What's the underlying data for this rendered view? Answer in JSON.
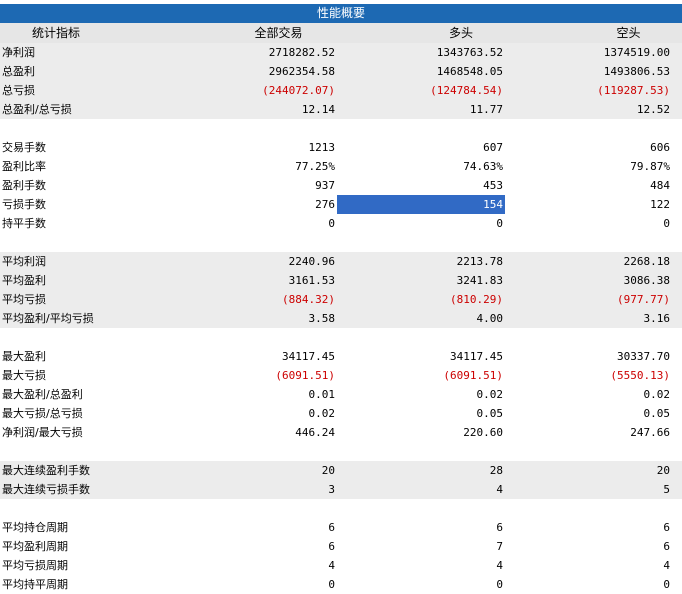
{
  "title": "性能概要",
  "header": [
    "统计指标",
    "全部交易",
    "多头",
    "空头"
  ],
  "colors": {
    "title_bg": "#1d69b3",
    "negative": "#cc0000",
    "selection": "#316ac5",
    "shade": "#ececec"
  },
  "section1": [
    [
      "净利润",
      "2718282.52",
      "1343763.52",
      "1374519.00"
    ],
    [
      "总盈利",
      "2962354.58",
      "1468548.05",
      "1493806.53"
    ],
    [
      "总亏损",
      "(244072.07)",
      "(124784.54)",
      "(119287.53)"
    ],
    [
      "总盈利/总亏损",
      "12.14",
      "11.77",
      "12.52"
    ]
  ],
  "section2": [
    [
      "交易手数",
      "1213",
      "607",
      "606"
    ],
    [
      "盈利比率",
      "77.25%",
      "74.63%",
      "79.87%"
    ],
    [
      "盈利手数",
      "937",
      "453",
      "484"
    ],
    [
      "亏损手数",
      "276",
      "154",
      "122"
    ],
    [
      "持平手数",
      "0",
      "0",
      "0"
    ]
  ],
  "section3": [
    [
      "平均利润",
      "2240.96",
      "2213.78",
      "2268.18"
    ],
    [
      "平均盈利",
      "3161.53",
      "3241.83",
      "3086.38"
    ],
    [
      "平均亏损",
      "(884.32)",
      "(810.29)",
      "(977.77)"
    ],
    [
      "平均盈利/平均亏损",
      "3.58",
      "4.00",
      "3.16"
    ]
  ],
  "section4": [
    [
      "最大盈利",
      "34117.45",
      "34117.45",
      "30337.70"
    ],
    [
      "最大亏损",
      "(6091.51)",
      "(6091.51)",
      "(5550.13)"
    ],
    [
      "最大盈利/总盈利",
      "0.01",
      "0.02",
      "0.02"
    ],
    [
      "最大亏损/总亏损",
      "0.02",
      "0.05",
      "0.05"
    ],
    [
      "净利润/最大亏损",
      "446.24",
      "220.60",
      "247.66"
    ]
  ],
  "section5": [
    [
      "最大连续盈利手数",
      "20",
      "28",
      "20"
    ],
    [
      "最大连续亏损手数",
      "3",
      "4",
      "5"
    ]
  ],
  "section6": [
    [
      "平均持仓周期",
      "6",
      "6",
      "6"
    ],
    [
      "平均盈利周期",
      "6",
      "7",
      "6"
    ],
    [
      "平均亏损周期",
      "4",
      "4",
      "4"
    ],
    [
      "平均持平周期",
      "0",
      "0",
      "0"
    ]
  ]
}
